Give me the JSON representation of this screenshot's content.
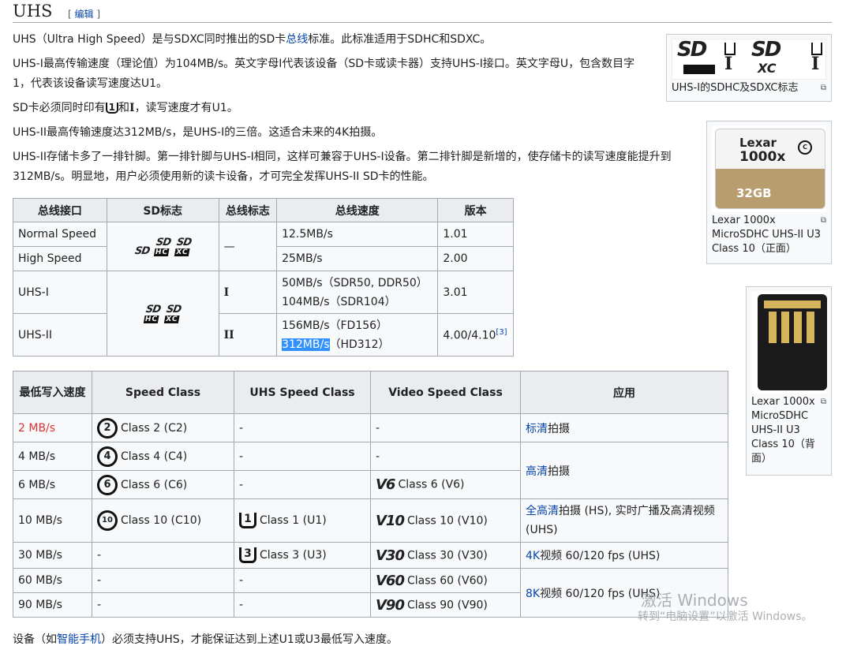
{
  "heading": {
    "title": "UHS",
    "edit_open": "[ ",
    "edit": "编辑",
    "edit_close": " ]"
  },
  "paragraphs": {
    "p1a": "UHS（Ultra High Speed）是与SDXC同时推出的SD卡",
    "p1_link": "总线",
    "p1b": "标准。此标准适用于SDHC和SDXC。",
    "p2": "UHS-I最高传输速度（理论值）为104MB/s。英文字母I代表该设备（SD卡或读卡器）支持UHS-I接口。英文字母U，包含数目字1，代表该设备读写速度达U1。",
    "p3a": "SD卡必须同时印有",
    "p3_u1": "1",
    "p3b": "和",
    "p3_i": "I",
    "p3c": "，读写速度才有U1。",
    "p4": "UHS-II最高传输速度达312MB/s，是UHS-I的三倍。这适合未来的4K拍摄。",
    "p5": "UHS-II存储卡多了一排针脚。第一排针脚与UHS-I相同，这样可兼容于UHS-I设备。第二排针脚是新增的，使存储卡的读写速度能提升到312MB/s。明显地，用户必须使用新的读卡设备，才可完全发挥UHS-II SD卡的性能。"
  },
  "table1": {
    "headers": [
      "总线接口",
      "SD标志",
      "总线标志",
      "总线速度",
      "版本"
    ],
    "rows": [
      {
        "iface": "Normal Speed",
        "bus": "—",
        "speed": "12.5MB/s",
        "ver": "1.01"
      },
      {
        "iface": "High Speed",
        "speed": "25MB/s",
        "ver": "2.00"
      },
      {
        "iface": "UHS-I",
        "bus": "I",
        "speed1": "50MB/s（SDR50, DDR50）",
        "speed2": "104MB/s（SDR104）",
        "ver": "3.01"
      },
      {
        "iface": "UHS-II",
        "bus": "II",
        "speed1": "156MB/s（FD156）",
        "speed2_hl": "312MB/s",
        "speed2": "（HD312）",
        "ver": "4.00/4.10",
        "ref": "[3]"
      }
    ]
  },
  "table2": {
    "headers": [
      "最低写入速度",
      "Speed Class",
      "UHS Speed Class",
      "Video Speed Class",
      "应用"
    ],
    "rows": [
      {
        "min_num": "2 ",
        "min_unit": "MB/s",
        "sc_icon": "2",
        "sc": "Class 2 (C2)",
        "uhs": "-",
        "vsc": "-",
        "app_link": "标清",
        "app": "拍摄"
      },
      {
        "min": "4 MB/s",
        "sc_icon": "4",
        "sc": "Class 4 (C4)",
        "uhs": "-",
        "vsc": "-",
        "app_link": "高清",
        "app": "拍摄"
      },
      {
        "min": "6 MB/s",
        "sc_icon": "6",
        "sc": "Class 6 (C6)",
        "uhs": "-",
        "vsc_icon": "V6",
        "vsc": "Class 6 (V6)"
      },
      {
        "min": "10 MB/s",
        "sc_icon": "10",
        "sc": "Class 10 (C10)",
        "uhs_icon": "1",
        "uhs": "Class 1 (U1)",
        "vsc_icon": "V10",
        "vsc": "Class 10 (V10)",
        "app_link": "全高清",
        "app": "拍摄 (HS), 实时广播及高清视频 (UHS)"
      },
      {
        "min": "30 MB/s",
        "sc": "-",
        "uhs_icon": "3",
        "uhs": "Class 3 (U3)",
        "vsc_icon": "V30",
        "vsc": "Class 30 (V30)",
        "app_link": "4K",
        "app": "视频 60/120 fps (UHS)"
      },
      {
        "min": "60 MB/s",
        "sc": "-",
        "uhs": "-",
        "vsc_icon": "V60",
        "vsc": "Class 60 (V60)",
        "app_link": "8K",
        "app": "视频 60/120 fps (UHS)"
      },
      {
        "min": "90 MB/s",
        "sc": "-",
        "uhs": "-",
        "vsc_icon": "V90",
        "vsc": "Class 90 (V90)"
      }
    ]
  },
  "thumbs": {
    "t1_caption": "UHS-I的SDHC及SDXC标志",
    "t2_caption": "Lexar 1000x MicroSDHC UHS-II U3 Class 10（正面）",
    "t2_brand": "Lexar",
    "t2_speed": "1000x",
    "t2_cap": "32GB",
    "t3_caption": "Lexar 1000x MicroSDHC UHS-II U3 Class 10（背面）",
    "magnify": "⧉"
  },
  "footer": {
    "a": "设备（如",
    "link": "智能手机",
    "b": "）必须支持UHS，才能保证达到上述U1或U3最低写入速度。"
  },
  "watermark": {
    "line1": "激活 Windows",
    "line2": "转到“电脑设置”以激活 Windows。"
  }
}
